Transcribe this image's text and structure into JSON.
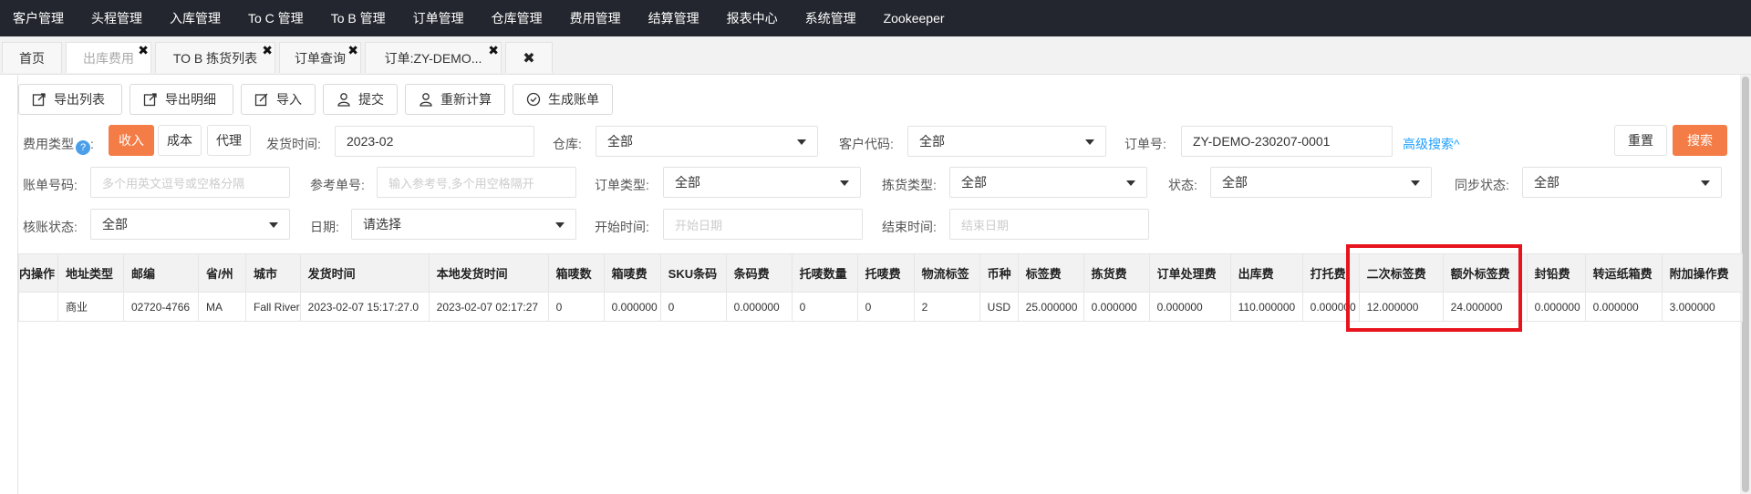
{
  "topnav": {
    "items": [
      "客户管理",
      "头程管理",
      "入库管理",
      "To C 管理",
      "To B 管理",
      "订单管理",
      "仓库管理",
      "费用管理",
      "结算管理",
      "报表中心",
      "系统管理",
      "Zookeeper"
    ]
  },
  "tabs": {
    "home": "首页",
    "items": [
      "出库费用",
      "TO B 拣货列表",
      "订单查询",
      "订单:ZY-DEMO..."
    ],
    "close_glyph": "✖"
  },
  "toolbar": {
    "buttons": [
      "导出列表",
      "导出明细",
      "导入",
      "提交",
      "重新计算",
      "生成账单"
    ]
  },
  "filters": {
    "fee_type_label": "费用类型",
    "fee_type_help": "?",
    "fee_type_colon": ":",
    "fee_type_options": [
      "收入",
      "成本",
      "代理"
    ],
    "ship_time_label": "发货时间:",
    "ship_time_value": "2023-02",
    "warehouse_label": "仓库:",
    "warehouse_value": "全部",
    "customer_code_label": "客户代码:",
    "customer_code_value": "全部",
    "order_no_label": "订单号:",
    "order_no_value": "ZY-DEMO-230207-0001",
    "advanced_search": "高级搜索^",
    "reset": "重置",
    "search": "搜索",
    "bill_no_label": "账单号码:",
    "bill_no_placeholder": "多个用英文逗号或空格分隔",
    "ref_no_label": "参考单号:",
    "ref_no_placeholder": "输入参考号,多个用空格隔开",
    "order_type_label": "订单类型:",
    "order_type_value": "全部",
    "pick_type_label": "拣货类型:",
    "pick_type_value": "全部",
    "status_label": "状态:",
    "status_value": "全部",
    "sync_status_label": "同步状态:",
    "sync_status_value": "全部",
    "check_status_label": "核账状态:",
    "check_status_value": "全部",
    "date_label": "日期:",
    "date_value": "请选择",
    "start_time_label": "开始时间:",
    "start_time_placeholder": "开始日期",
    "end_time_label": "结束时间:",
    "end_time_placeholder": "结束日期"
  },
  "table": {
    "headers": [
      "内操作",
      "地址类型",
      "邮编",
      "省/州",
      "城市",
      "发货时间",
      "本地发货时间",
      "箱唛数",
      "箱唛费",
      "SKU条码",
      "条码费",
      "托唛数量",
      "托唛费",
      "物流标签",
      "币种",
      "标签费",
      "拣货费",
      "订单处理费",
      "出库费",
      "打托费",
      "二次标签费",
      "额外标签费",
      "封铅费",
      "转运纸箱费",
      "附加操作费"
    ],
    "rows": [
      [
        "",
        "商业",
        "02720-4766",
        "MA",
        "Fall River",
        "2023-02-07 15:17:27.0",
        "2023-02-07 02:17:27",
        "0",
        "0.000000",
        "0",
        "0.000000",
        "0",
        "0",
        "2",
        "USD",
        "25.000000",
        "0.000000",
        "0.000000",
        "110.000000",
        "0.000000",
        "12.000000",
        "24.000000",
        "0.000000",
        "0.000000",
        "3.000000"
      ]
    ]
  },
  "colors": {
    "topnav_bg": "#23262e",
    "accent_orange": "#f47d47",
    "link_blue": "#1e9fff",
    "highlight_red": "#e8141d"
  }
}
